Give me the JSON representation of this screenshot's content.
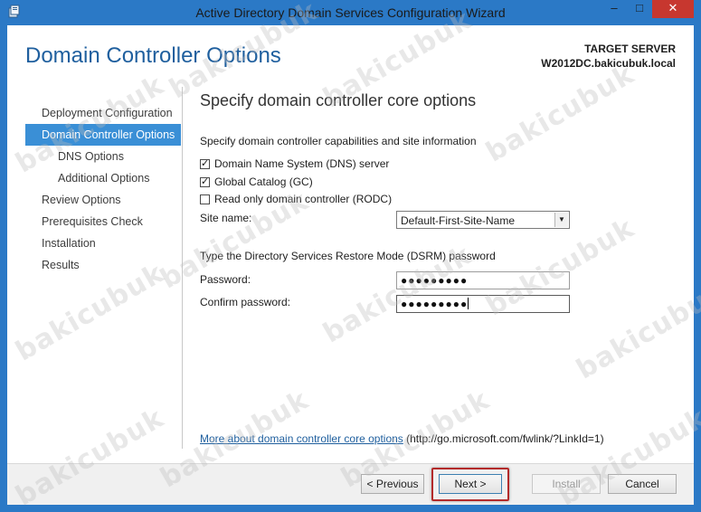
{
  "window": {
    "title": "Active Directory Domain Services Configuration Wizard",
    "min_glyph": "–",
    "max_glyph": "□",
    "close_glyph": "✕"
  },
  "header": {
    "page_title": "Domain Controller Options",
    "target_label": "TARGET SERVER",
    "target_value": "W2012DC.bakicubuk.local"
  },
  "nav": {
    "items": [
      {
        "label": "Deployment Configuration"
      },
      {
        "label": "Domain Controller Options"
      },
      {
        "label": "DNS Options"
      },
      {
        "label": "Additional Options"
      },
      {
        "label": "Review Options"
      },
      {
        "label": "Prerequisites Check"
      },
      {
        "label": "Installation"
      },
      {
        "label": "Results"
      }
    ]
  },
  "main": {
    "section_title": "Specify domain controller core options",
    "capabilities_heading": "Specify domain controller capabilities and site information",
    "checkboxes": [
      {
        "label": "Domain Name System (DNS) server",
        "checked": true
      },
      {
        "label": "Global Catalog (GC)",
        "checked": true
      },
      {
        "label": "Read only domain controller (RODC)",
        "checked": false
      }
    ],
    "site_label": "Site name:",
    "site_value": "Default-First-Site-Name",
    "dsrm_heading": "Type the Directory Services Restore Mode (DSRM) password",
    "password_label": "Password:",
    "password_value": "●●●●●●●●●",
    "confirm_label": "Confirm password:",
    "confirm_value": "●●●●●●●●●",
    "more_link": "More about domain controller core options",
    "more_url": "(http://go.microsoft.com/fwlink/?LinkId=1)"
  },
  "footer": {
    "previous": "< Previous",
    "next": "Next >",
    "install": "Install",
    "cancel": "Cancel"
  },
  "watermark": "bakicubuk",
  "colors": {
    "accent": "#2b79c6",
    "nav_active": "#3a8fd6",
    "title_blue": "#1f5f9e",
    "highlight_red": "#b32a2a"
  }
}
